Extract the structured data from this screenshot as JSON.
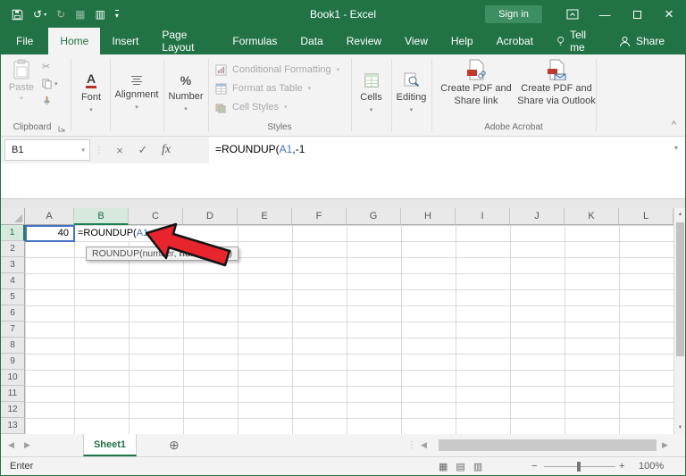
{
  "titlebar": {
    "title": "Book1 - Excel",
    "sign_in_label": "Sign in"
  },
  "tabs": {
    "file_label": "File",
    "items": [
      "Home",
      "Insert",
      "Page Layout",
      "Formulas",
      "Data",
      "Review",
      "View",
      "Help",
      "Acrobat"
    ],
    "tell_me_label": "Tell me",
    "share_label": "Share"
  },
  "ribbon": {
    "clipboard": {
      "paste_label": "Paste",
      "group_label": "Clipboard"
    },
    "font": {
      "button_label": "Font",
      "icon_letter": "A"
    },
    "alignment": {
      "button_label": "Alignment"
    },
    "number": {
      "button_label": "Number",
      "icon_symbol": "%"
    },
    "styles": {
      "items": [
        "Conditional Formatting",
        "Format as Table",
        "Cell Styles"
      ],
      "group_label": "Styles"
    },
    "cells": {
      "button_label": "Cells"
    },
    "editing": {
      "button_label": "Editing"
    },
    "acrobat": {
      "button1_label": "Create PDF and Share link",
      "button2_label": "Create PDF and Share via Outlook",
      "group_label": "Adobe Acrobat"
    }
  },
  "formula_bar": {
    "name_box_value": "B1",
    "fx_label": "fx"
  },
  "formula": {
    "pre": "=ROUNDUP(",
    "ref": "A1",
    "post": ",-1"
  },
  "grid": {
    "columns": [
      "A",
      "B",
      "C",
      "D",
      "E",
      "F",
      "G",
      "H",
      "I",
      "J",
      "K",
      "L"
    ],
    "rows": [
      "1",
      "2",
      "3",
      "4",
      "5",
      "6",
      "7",
      "8",
      "9",
      "10",
      "11",
      "12",
      "13"
    ],
    "a1_value": "40",
    "active_cell": "B1",
    "tooltip": {
      "pre": "ROUNDUP(number, ",
      "bold": "num_digits",
      "post": ")"
    }
  },
  "sheet_bar": {
    "sheet_name": "Sheet1"
  },
  "status_bar": {
    "mode": "Enter",
    "zoom_value": "100%"
  },
  "colors": {
    "theme_green": "#217346",
    "sign_in_green": "#3e8e63",
    "reference_blue": "#4472c4",
    "arrow_red": "#e8242c",
    "active_header_fill": "#d7e8dd"
  },
  "icons": {
    "undo": "↺",
    "redo": "↻",
    "dropdown": "▾",
    "cut": "✂",
    "dots": "⋮",
    "check": "✓",
    "cancel": "×",
    "minimize": "—",
    "close": "×",
    "prev": "◀",
    "next": "▶",
    "up": "▲",
    "down": "▼",
    "new_sheet": "⊕",
    "collapse_ribbon": "^",
    "expand_formula": "▾",
    "normal_view": "▦",
    "page_layout_view": "▤",
    "page_break_view": "▥",
    "zoom_out": "−",
    "zoom_in": "+",
    "touch_mode": "▦",
    "grid_mode": "▥"
  }
}
